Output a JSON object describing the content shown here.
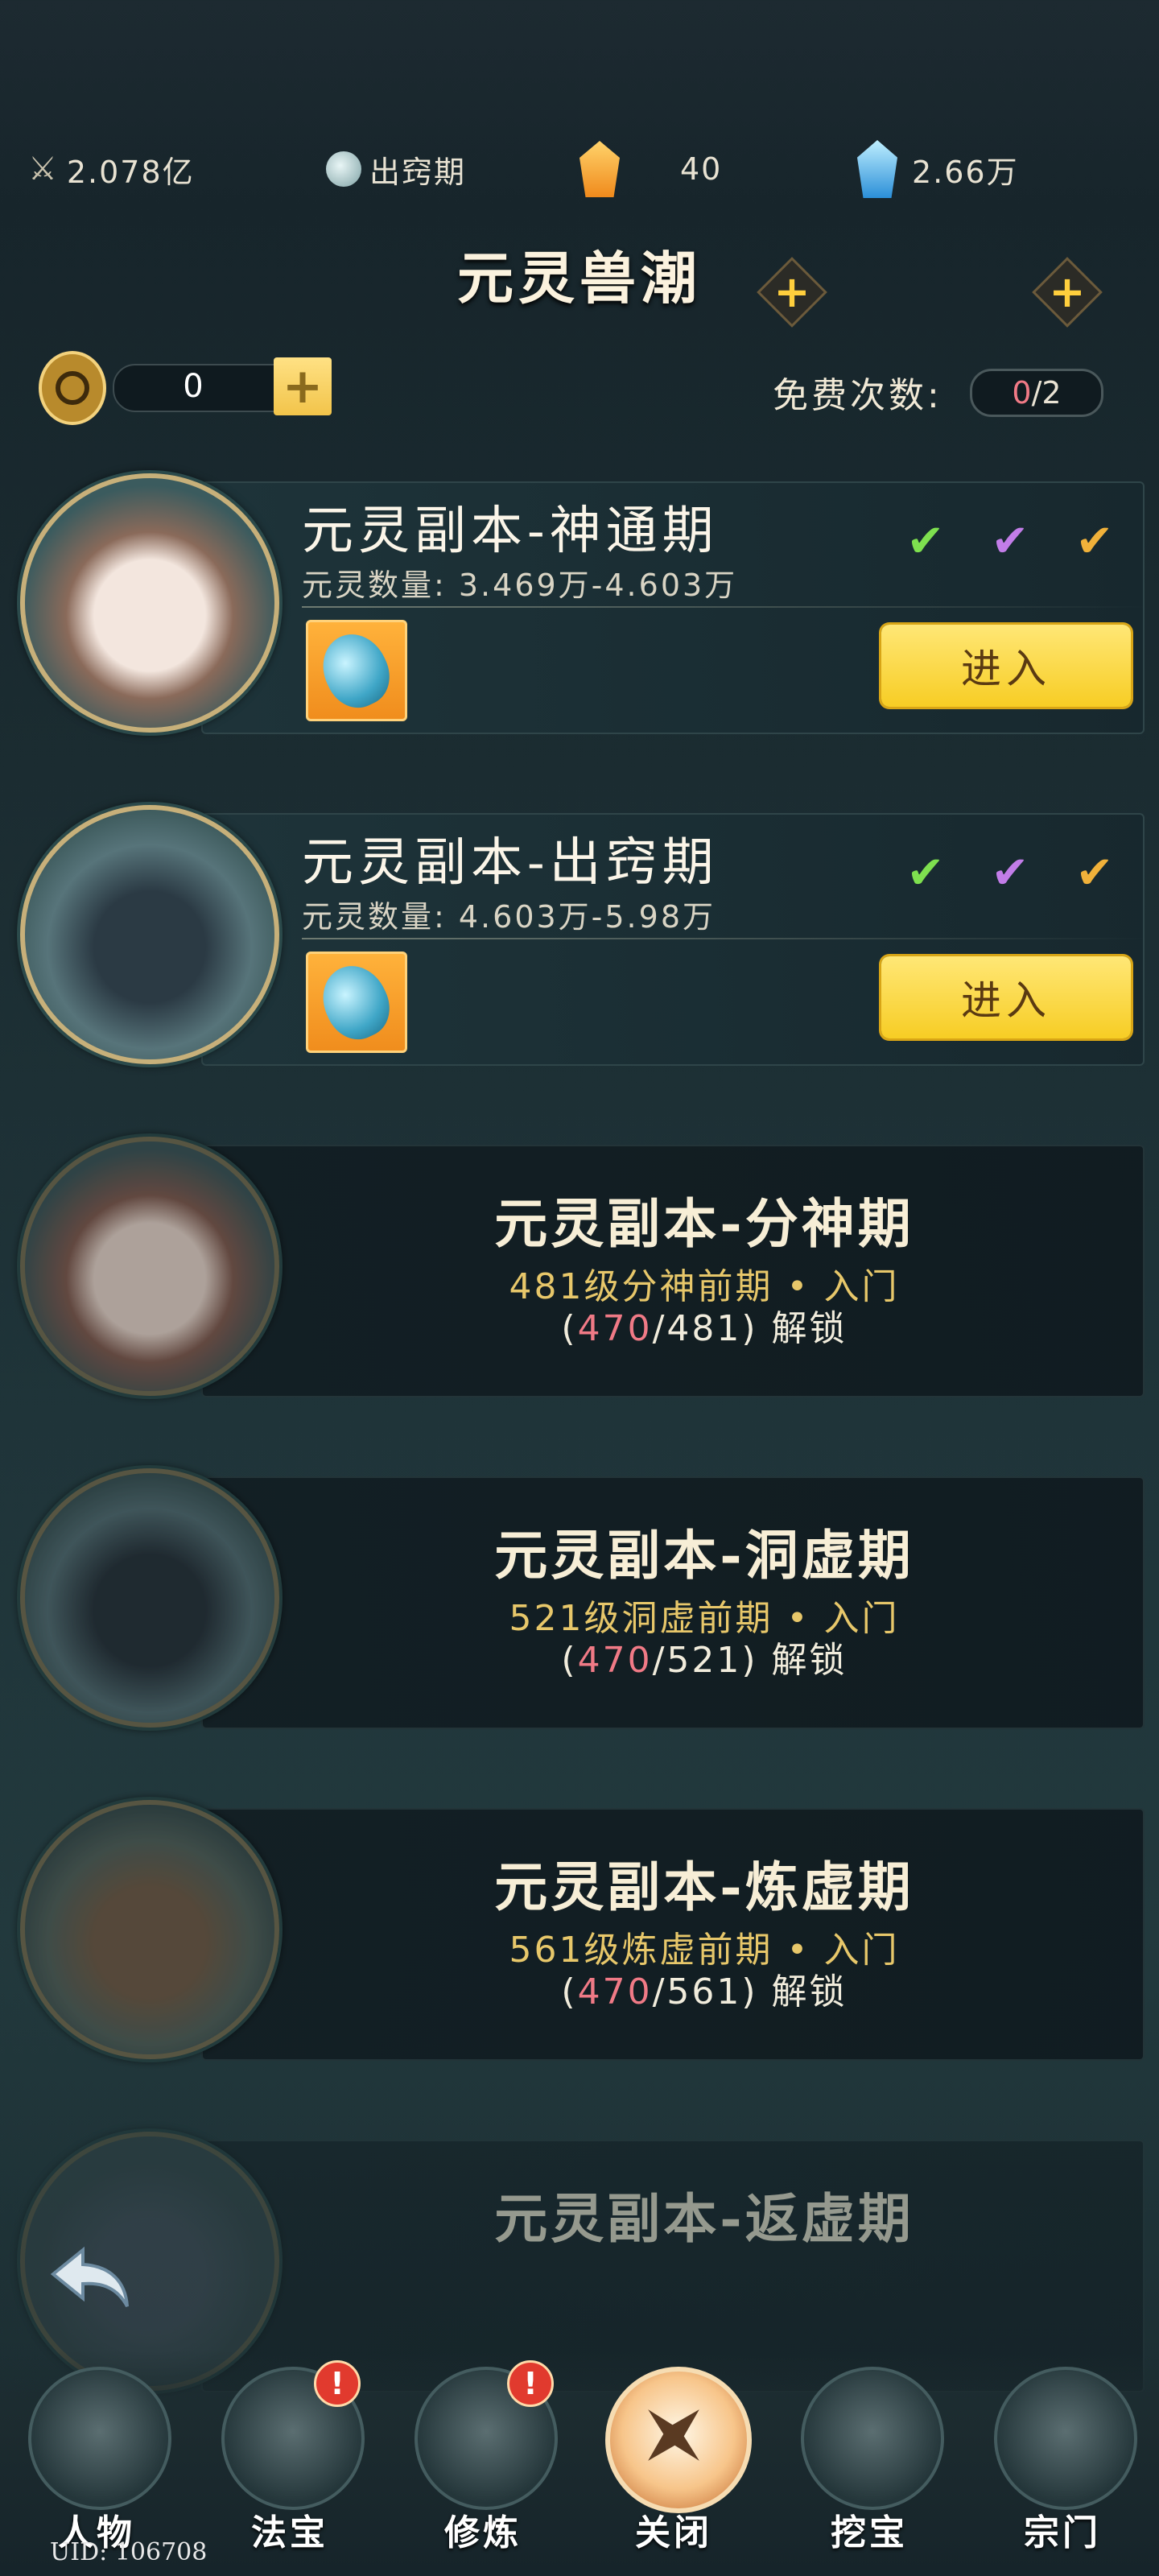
{
  "topbar": {
    "power": "2.078亿",
    "realm": "出窍期",
    "orange_gem_count": "40",
    "blue_gem_count": "2.66万",
    "plus": "+"
  },
  "title": "元灵兽潮",
  "ticket": {
    "count": "0",
    "add": "+"
  },
  "free": {
    "label": "免费次数:",
    "used": "0",
    "total": "/2"
  },
  "cards": [
    {
      "title": "元灵副本-神通期",
      "sub": "元灵数量: 3.469万-4.603万",
      "enter": "进入"
    },
    {
      "title": "元灵副本-出窍期",
      "sub": "元灵数量: 4.603万-5.98万",
      "enter": "进入"
    }
  ],
  "locked": [
    {
      "title": "元灵副本-分神期",
      "req": "481级分神前期 • 入门",
      "open": "(",
      "cur": "470",
      "rest": "/481)",
      "unlock": " 解锁"
    },
    {
      "title": "元灵副本-洞虚期",
      "req": "521级洞虚前期 • 入门",
      "open": "(",
      "cur": "470",
      "rest": "/521)",
      "unlock": " 解锁"
    },
    {
      "title": "元灵副本-炼虚期",
      "req": "561级炼虚前期 • 入门",
      "open": "(",
      "cur": "470",
      "rest": "/561)",
      "unlock": " 解锁"
    },
    {
      "title": "元灵副本-返虚期"
    }
  ],
  "nav": {
    "items": [
      "人物",
      "法宝",
      "修炼",
      "关闭",
      "挖宝",
      "宗门"
    ],
    "badge": "!"
  },
  "uid": "UID: 106708",
  "colors": {
    "gold_button": "#f7cd24",
    "progress_red": "#f07a86",
    "requirement_gold": "#e7c76a"
  }
}
